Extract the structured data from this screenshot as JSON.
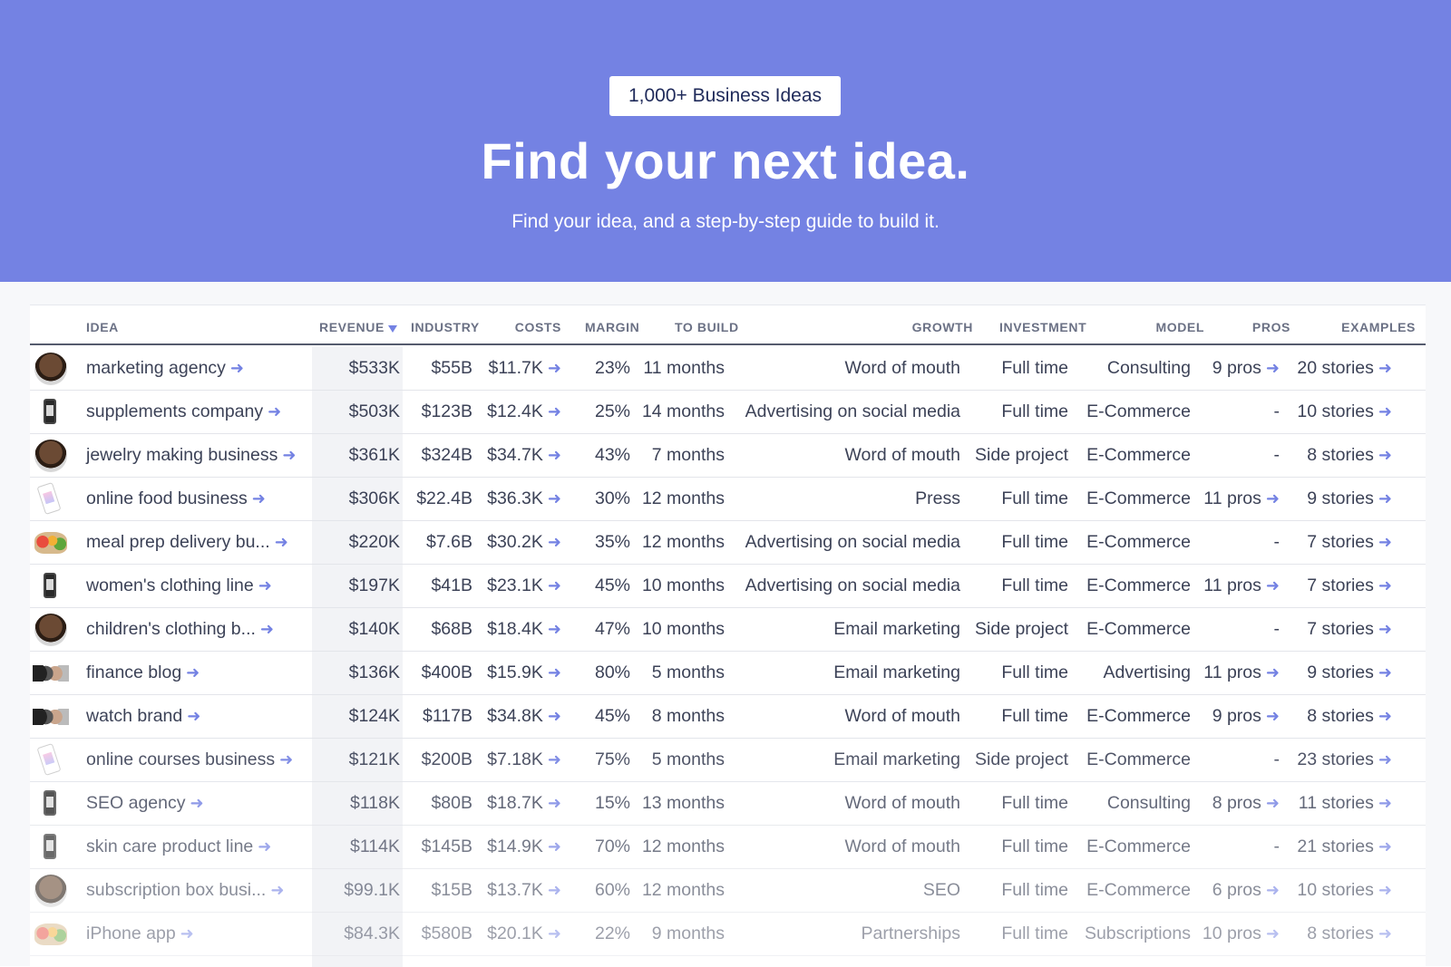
{
  "hero": {
    "badge": "1,000+ Business Ideas",
    "title": "Find your next idea.",
    "subtitle": "Find your idea, and a step-by-step guide to build it."
  },
  "colors": {
    "hero_bg": "#7482e3",
    "accent": "#7482e3",
    "text": "#3c4257"
  },
  "table": {
    "headers": {
      "idea": "IDEA",
      "revenue": "REVENUE",
      "industry": "INDUSTRY",
      "costs": "COSTS",
      "margin": "MARGIN",
      "to_build": "TO BUILD",
      "growth": "GROWTH",
      "investment": "INVESTMENT",
      "model": "MODEL",
      "pros": "PROS",
      "examples": "EXAMPLES"
    },
    "rows": [
      {
        "thumb": "face",
        "idea": "marketing agency",
        "revenue": "$533K",
        "industry": "$55B",
        "costs": "$11.7K",
        "margin": "23%",
        "to_build": "11 months",
        "growth": "Word of mouth",
        "investment": "Full time",
        "model": "Consulting",
        "pros": "9 pros",
        "examples": "20 stories"
      },
      {
        "thumb": "phone",
        "idea": "supplements company",
        "revenue": "$503K",
        "industry": "$123B",
        "costs": "$12.4K",
        "margin": "25%",
        "to_build": "14 months",
        "growth": "Advertising on social media",
        "investment": "Full time",
        "model": "E-Commerce",
        "pros": "-",
        "examples": "10 stories"
      },
      {
        "thumb": "face",
        "idea": "jewelry making business",
        "revenue": "$361K",
        "industry": "$324B",
        "costs": "$34.7K",
        "margin": "43%",
        "to_build": "7 months",
        "growth": "Word of mouth",
        "investment": "Side project",
        "model": "E-Commerce",
        "pros": "-",
        "examples": "8 stories"
      },
      {
        "thumb": "phone2",
        "idea": "online food business",
        "revenue": "$306K",
        "industry": "$22.4B",
        "costs": "$36.3K",
        "margin": "30%",
        "to_build": "12 months",
        "growth": "Press",
        "investment": "Full time",
        "model": "E-Commerce",
        "pros": "11 pros",
        "examples": "9 stories"
      },
      {
        "thumb": "fruit",
        "idea": "meal prep delivery bu...",
        "revenue": "$220K",
        "industry": "$7.6B",
        "costs": "$30.2K",
        "margin": "35%",
        "to_build": "12 months",
        "growth": "Advertising on social media",
        "investment": "Full time",
        "model": "E-Commerce",
        "pros": "-",
        "examples": "7 stories"
      },
      {
        "thumb": "phone",
        "idea": "women's clothing line",
        "revenue": "$197K",
        "industry": "$41B",
        "costs": "$23.1K",
        "margin": "45%",
        "to_build": "10 months",
        "growth": "Advertising on social media",
        "investment": "Full time",
        "model": "E-Commerce",
        "pros": "11 pros",
        "examples": "7 stories"
      },
      {
        "thumb": "face",
        "idea": "children's clothing b...",
        "revenue": "$140K",
        "industry": "$68B",
        "costs": "$18.4K",
        "margin": "47%",
        "to_build": "10 months",
        "growth": "Email marketing",
        "investment": "Side project",
        "model": "E-Commerce",
        "pros": "-",
        "examples": "7 stories"
      },
      {
        "thumb": "watch",
        "idea": "finance blog",
        "revenue": "$136K",
        "industry": "$400B",
        "costs": "$15.9K",
        "margin": "80%",
        "to_build": "5 months",
        "growth": "Email marketing",
        "investment": "Full time",
        "model": "Advertising",
        "pros": "11 pros",
        "examples": "9 stories"
      },
      {
        "thumb": "watch",
        "idea": "watch brand",
        "revenue": "$124K",
        "industry": "$117B",
        "costs": "$34.8K",
        "margin": "45%",
        "to_build": "8 months",
        "growth": "Word of mouth",
        "investment": "Full time",
        "model": "E-Commerce",
        "pros": "9 pros",
        "examples": "8 stories"
      },
      {
        "thumb": "phone2",
        "idea": "online courses business",
        "revenue": "$121K",
        "industry": "$200B",
        "costs": "$7.18K",
        "margin": "75%",
        "to_build": "5 months",
        "growth": "Email marketing",
        "investment": "Side project",
        "model": "E-Commerce",
        "pros": "-",
        "examples": "23 stories"
      },
      {
        "thumb": "phone",
        "idea": "SEO agency",
        "revenue": "$118K",
        "industry": "$80B",
        "costs": "$18.7K",
        "margin": "15%",
        "to_build": "13 months",
        "growth": "Word of mouth",
        "investment": "Full time",
        "model": "Consulting",
        "pros": "8 pros",
        "examples": "11 stories"
      },
      {
        "thumb": "phone",
        "idea": "skin care product line",
        "revenue": "$114K",
        "industry": "$145B",
        "costs": "$14.9K",
        "margin": "70%",
        "to_build": "12 months",
        "growth": "Word of mouth",
        "investment": "Full time",
        "model": "E-Commerce",
        "pros": "-",
        "examples": "21 stories"
      },
      {
        "thumb": "face",
        "idea": "subscription box busi...",
        "revenue": "$99.1K",
        "industry": "$15B",
        "costs": "$13.7K",
        "margin": "60%",
        "to_build": "12 months",
        "growth": "SEO",
        "investment": "Full time",
        "model": "E-Commerce",
        "pros": "6 pros",
        "examples": "10 stories"
      },
      {
        "thumb": "fruit",
        "idea": "iPhone app",
        "revenue": "$84.3K",
        "industry": "$580B",
        "costs": "$20.1K",
        "margin": "22%",
        "to_build": "9 months",
        "growth": "Partnerships",
        "investment": "Full time",
        "model": "Subscriptions",
        "pros": "10 pros",
        "examples": "8 stories"
      }
    ]
  },
  "icons": {
    "arrow": "arrow-right-icon",
    "sort": "sort-desc-icon"
  },
  "arrow_glyph": "➜"
}
